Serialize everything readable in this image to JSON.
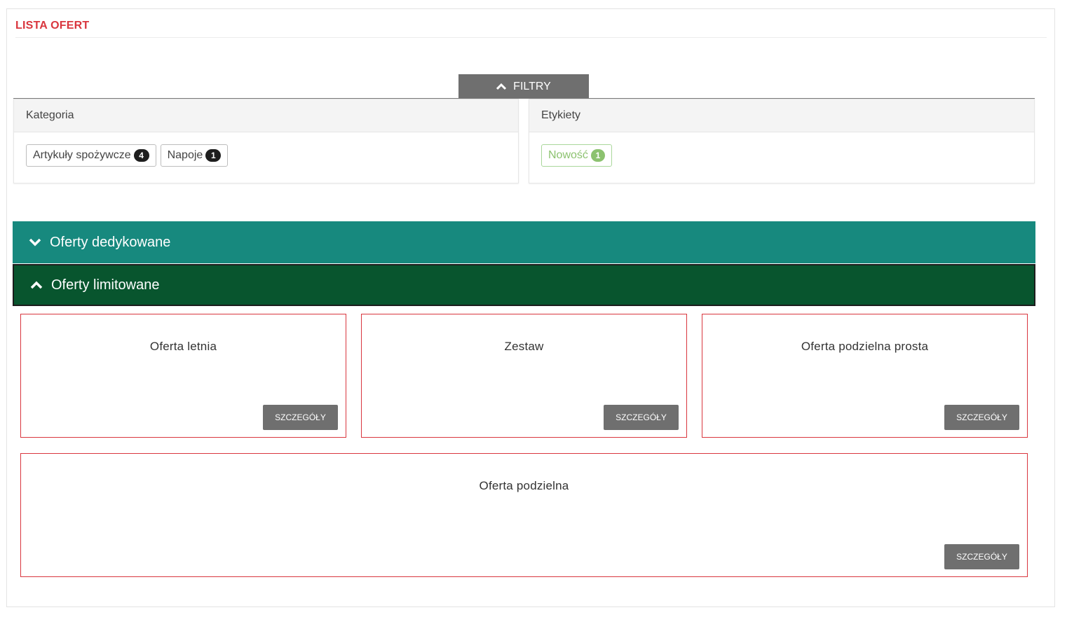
{
  "page": {
    "title": "LISTA OFERT"
  },
  "filters": {
    "toggle_label": "FILTRY",
    "category": {
      "header": "Kategoria",
      "chips": [
        {
          "label": "Artykuły spożywcze",
          "count": "4"
        },
        {
          "label": "Napoje",
          "count": "1"
        }
      ]
    },
    "tags": {
      "header": "Etykiety",
      "chips": [
        {
          "label": "Nowość",
          "count": "1"
        }
      ]
    }
  },
  "sections": {
    "dedicated": {
      "label": "Oferty dedykowane",
      "expanded": false,
      "color": "#17897e"
    },
    "limited": {
      "label": "Oferty limitowane",
      "expanded": true,
      "color": "#08552e"
    }
  },
  "offers": [
    {
      "name": "Oferta letnia",
      "button": "SZCZEGÓŁY"
    },
    {
      "name": "Zestaw",
      "button": "SZCZEGÓŁY"
    },
    {
      "name": "Oferta podzielna prosta",
      "button": "SZCZEGÓŁY"
    },
    {
      "name": "Oferta podzielna",
      "button": "SZCZEGÓŁY"
    }
  ],
  "colors": {
    "accent_red": "#d9363e",
    "button_gray": "#6f6f6f",
    "tag_green": "#8cc26f"
  }
}
